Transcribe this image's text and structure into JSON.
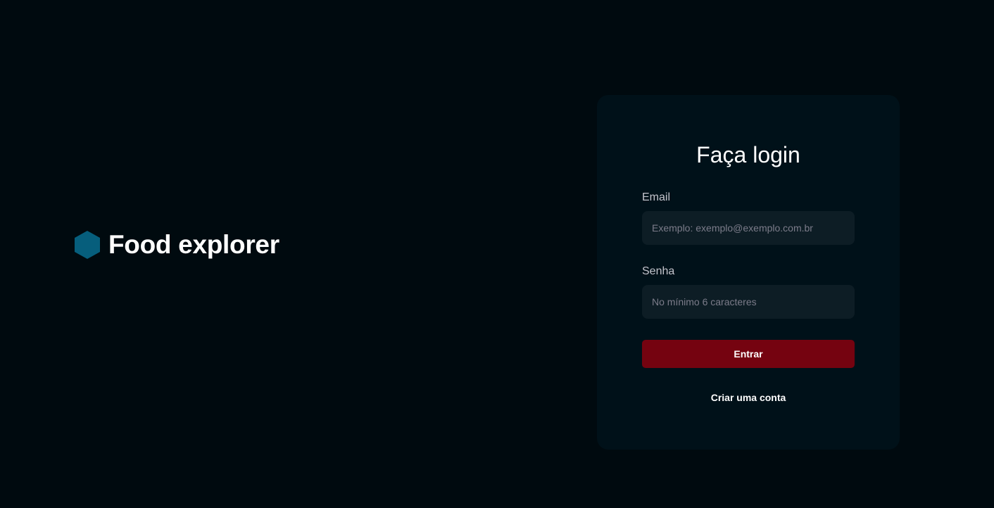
{
  "brand": {
    "name": "Food explorer",
    "icon": "hexagon-logo-icon",
    "icon_color": "#065e7c"
  },
  "login": {
    "title": "Faça login",
    "email": {
      "label": "Email",
      "value": "",
      "placeholder": "Exemplo: exemplo@exemplo.com.br"
    },
    "password": {
      "label": "Senha",
      "value": "",
      "placeholder": "No mínimo 6 caracteres"
    },
    "submit_label": "Entrar",
    "signup_label": "Criar uma conta"
  },
  "colors": {
    "background": "#000a0f",
    "card": "#001119",
    "input": "#0d1d25",
    "button": "#750310",
    "placeholder": "#7c7c8a"
  }
}
